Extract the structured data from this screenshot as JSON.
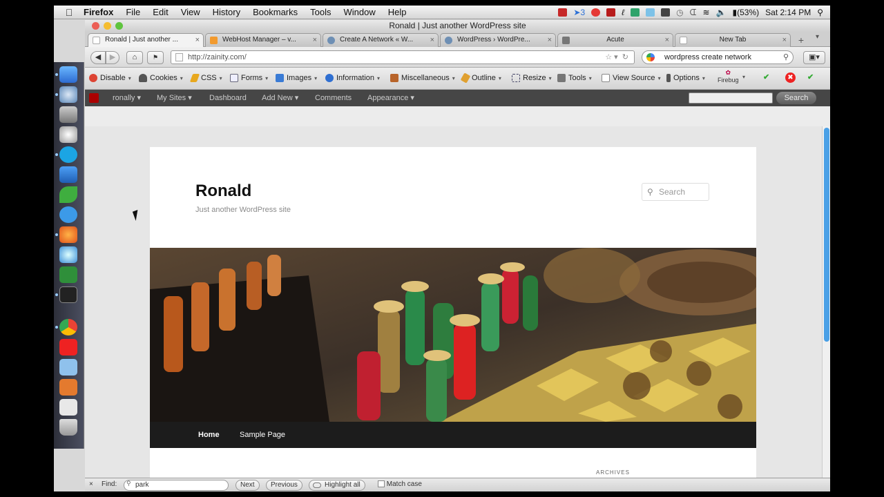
{
  "menubar": {
    "apple_icon": "apple-icon",
    "app_name": "Firefox",
    "menus": [
      "File",
      "Edit",
      "View",
      "History",
      "Bookmarks",
      "Tools",
      "Window",
      "Help"
    ],
    "status": {
      "badge_count": "3",
      "battery": "(53%)",
      "clock": "Sat 2:14 PM"
    }
  },
  "window": {
    "title": "Ronald | Just another WordPress site"
  },
  "tabs": [
    {
      "label": "Ronald | Just another ...",
      "active": true,
      "color": "#ffffff"
    },
    {
      "label": "WebHost Manager – v...",
      "active": false,
      "color": "#f29a2e"
    },
    {
      "label": "Create A Network « W...",
      "active": false,
      "color": "#6e8fb4"
    },
    {
      "label": "WordPress › WordPre...",
      "active": false,
      "color": "#6e8fb4"
    },
    {
      "label": "Acute",
      "active": false,
      "color": "#777777"
    },
    {
      "label": "New Tab",
      "active": false,
      "color": "#ffffff"
    }
  ],
  "navbar": {
    "url": "http://zainity.com/",
    "search_value": "wordpress create network"
  },
  "devbar": {
    "items": [
      "Disable",
      "Cookies",
      "CSS",
      "Forms",
      "Images",
      "Information",
      "Miscellaneous",
      "Outline",
      "Resize",
      "Tools",
      "View Source",
      "Options"
    ],
    "firebug": "Firebug"
  },
  "adminbar": {
    "items": [
      "ronally",
      "My Sites",
      "Dashboard",
      "Add New",
      "Comments",
      "Appearance"
    ],
    "search_button": "Search"
  },
  "site": {
    "title": "Ronald",
    "description": "Just another WordPress site",
    "search_placeholder": "Search",
    "nav": [
      "Home",
      "Sample Page"
    ],
    "sidebar_heading": "ARCHIVES"
  },
  "findbar": {
    "close": "×",
    "label": "Find:",
    "value": "park",
    "next": "Next",
    "previous": "Previous",
    "highlight": "Highlight all",
    "match_case": "Match case"
  },
  "colors": {
    "admin_bar": "#464646",
    "site_nav": "#1c1c1c",
    "scroll_thumb": "#4aa0e6"
  }
}
